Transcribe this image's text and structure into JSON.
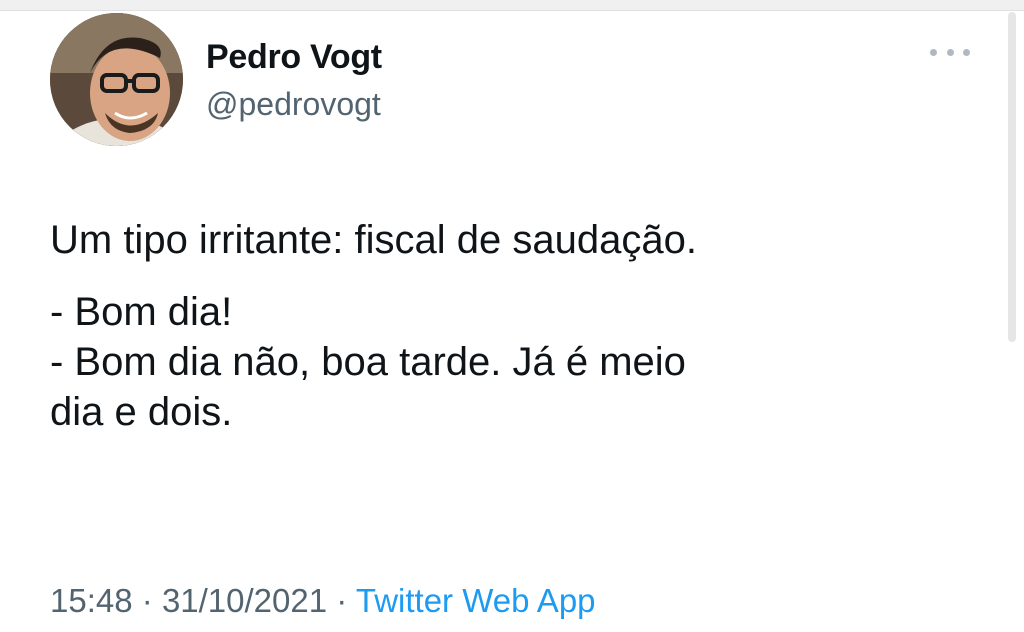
{
  "author": {
    "name": "Pedro Vogt",
    "handle": "@pedrovogt"
  },
  "tweet": {
    "lines": [
      "Um tipo irritante: fiscal de saudação.",
      "- Bom dia!",
      "- Bom dia não, boa tarde. Já é meio",
      "dia e dois."
    ]
  },
  "meta": {
    "time": "15:48",
    "separator": "·",
    "date": "31/10/2021",
    "source": "Twitter Web App"
  },
  "icons": {
    "more": "more-horizontal-icon",
    "avatar": "profile-photo"
  },
  "colors": {
    "text": "#0f1419",
    "secondary": "#536471",
    "link": "#1d9bf0"
  }
}
